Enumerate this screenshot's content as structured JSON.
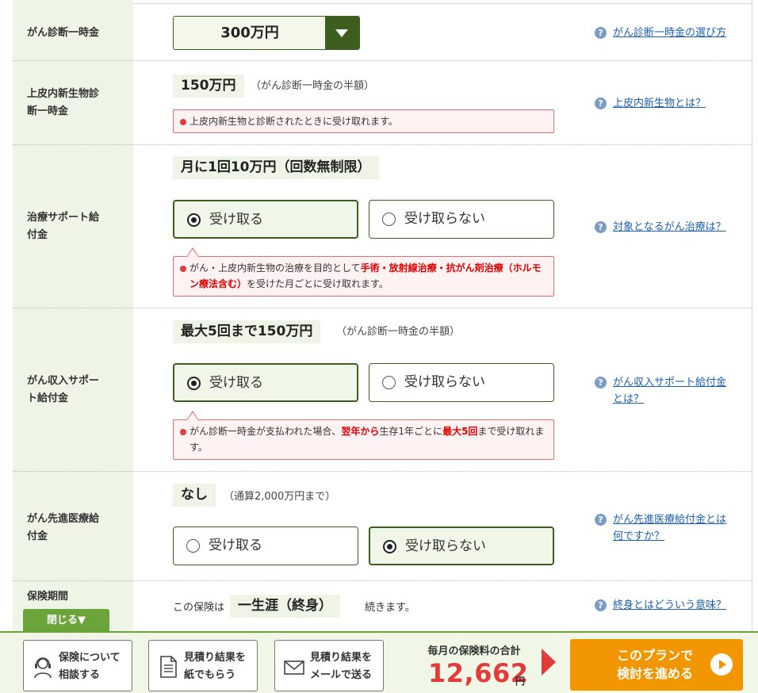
{
  "rows": {
    "diagnosis": {
      "label": "がん診断一時金",
      "select_value": "300万円",
      "help": "がん診断一時金の選び方"
    },
    "carcinoma": {
      "label_line1": "上皮内新生物診",
      "label_line2": "断一時金",
      "amount": "150万円",
      "note": "（がん診断一時金の半額）",
      "alert": "上皮内新生物と診断されたときに受け取れます。",
      "help": "上皮内新生物とは？"
    },
    "treatment": {
      "label_line1": "治療サポート給",
      "label_line2": "付金",
      "amount": "月に1回10万円（回数無制限）",
      "option_receive": "受け取る",
      "option_decline": "受け取らない",
      "alert_part1": "がん・上皮内新生物の治療を目的として",
      "alert_red": "手術・放射線治療・抗がん剤治療（ホルモン療法含む）",
      "alert_part2": "を受けた月ごとに受け取れます。",
      "help": "対象となるがん治療は？"
    },
    "income": {
      "label_line1": "がん収入サポー",
      "label_line2": "ト給付金",
      "amount": "最大5回まで150万円",
      "note": "（がん診断一時金の半額）",
      "option_receive": "受け取る",
      "option_decline": "受け取らない",
      "alert_part1": "がん診断一時金が支払われた場合、",
      "alert_red1": "翌年から",
      "alert_part2": "生存1年ごとに",
      "alert_red2": "最大5回",
      "alert_part3": "まで受け取れます。",
      "help_line1": "がん収入サポート給付金",
      "help_line2": "とは？"
    },
    "advanced": {
      "label_line1": "がん先進医療給",
      "label_line2": "付金",
      "amount": "なし",
      "note": "（通算2,000万円まで）",
      "option_receive": "受け取る",
      "option_decline": "受け取らない",
      "help_line1": "がん先進医療給付金とは",
      "help_line2": "何ですか？"
    },
    "period": {
      "label": "保険期間",
      "text_before": "この保険は",
      "amount": "一生涯（終身）",
      "text_after": "続きます。",
      "help": "終身とはどういう意味？"
    }
  },
  "close_button": "閉じる▼",
  "footer": {
    "consult_line1": "保険について",
    "consult_line2": "相談する",
    "paper_line1": "見積り結果を",
    "paper_line2": "紙でもらう",
    "mail_line1": "見積り結果を",
    "mail_line2": "メールで送る",
    "total_label": "毎月の保険料の合計",
    "total_value": "12,662",
    "total_unit": "円",
    "cta_line1": "このプランで",
    "cta_line2": "検討を進める"
  },
  "colors": {
    "accent_green": "#3d5e1f",
    "footer_green": "#6aa43a",
    "alert_red": "#e33b3b",
    "cta_orange": "#f29600",
    "link_blue": "#1a5fb4"
  }
}
